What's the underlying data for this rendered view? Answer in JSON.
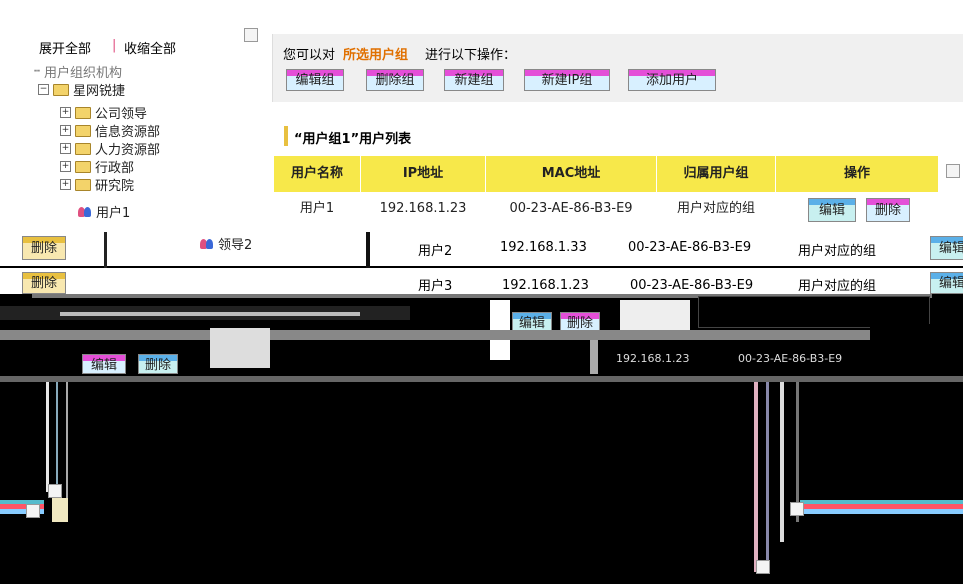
{
  "tree": {
    "expand_all": "展开全部",
    "separator": "|",
    "collapse_all": "收缩全部",
    "root": "用户组织机构",
    "org": "星网锐捷",
    "items": [
      "公司领导",
      "信息资源部",
      "人力资源部",
      "行政部",
      "研究院"
    ],
    "user_leaf": "用户1",
    "leader_leaf": "领导2"
  },
  "ops": {
    "prefix": "您可以对",
    "target": "所选用户组",
    "suffix": "进行以下操作：",
    "buttons": [
      "编辑组",
      "删除组",
      "新建组",
      "新建IP组",
      "添加用户"
    ]
  },
  "list": {
    "title": "“用户组1”用户列表",
    "headers": [
      "用户名称",
      "IP地址",
      "MAC地址",
      "归属用户组",
      "操作"
    ],
    "rows": [
      {
        "name": "用户1",
        "ip": "192.168.1.23",
        "mac": "00-23-AE-86-B3-E9",
        "group": "用户对应的组",
        "edit": "编辑",
        "delete": "删除"
      },
      {
        "name": "用户2",
        "ip": "192.168.1.33",
        "mac": "00-23-AE-86-B3-E9",
        "group": "用户对应的组",
        "edit": "编辑",
        "delete": "删除"
      },
      {
        "name": "用户3",
        "ip": "192.168.1.23",
        "mac": "00-23-AE-86-B3-E9",
        "group": "用户对应的组",
        "edit": "编辑",
        "delete": "删除"
      }
    ]
  },
  "colors": {
    "pink": "#e44fd8",
    "yellow": "#f7e84a",
    "orange": "#e07000"
  }
}
